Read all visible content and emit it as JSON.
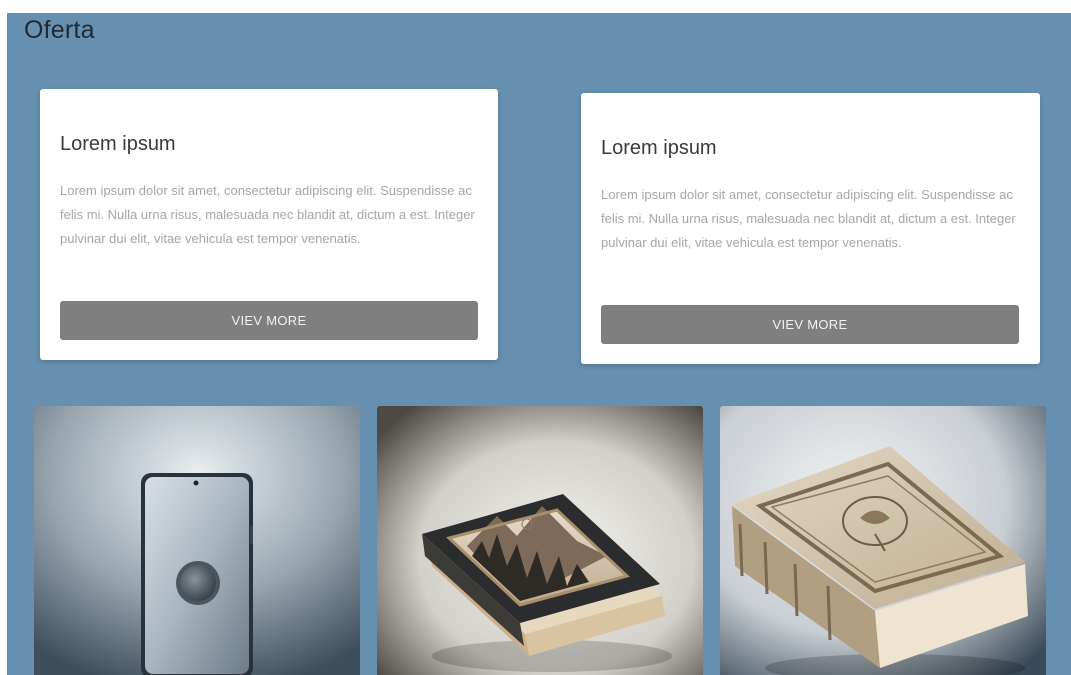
{
  "section": {
    "title": "Oferta"
  },
  "cards": [
    {
      "title": "Lorem ipsum",
      "text": "Lorem ipsum dolor sit amet, consectetur adipiscing elit. Suspendisse ac felis mi. Nulla urna risus, malesuada nec blandit at, dictum a est. Integer pulvinar dui elit, vitae vehicula est tempor venenatis.",
      "button_label": "VIEV MORE"
    },
    {
      "title": "Lorem ipsum",
      "text": "Lorem ipsum dolor sit amet, consectetur adipiscing elit. Suspendisse ac felis mi. Nulla urna risus, malesuada nec blandit at, dictum a est. Integer pulvinar dui elit, vitae vehicula est tempor venenatis.",
      "button_label": "VIEV MORE"
    }
  ],
  "products": [
    {
      "image": "smartphone-image"
    },
    {
      "image": "illustrated-book-image"
    },
    {
      "image": "ornate-book-image"
    }
  ],
  "colors": {
    "page_background": "#6790b0",
    "card_background": "#ffffff",
    "button_background": "#7f7f7f",
    "button_text": "#f2f2f2",
    "title_text": "#1f2a33",
    "body_text": "#a6a6a6"
  }
}
